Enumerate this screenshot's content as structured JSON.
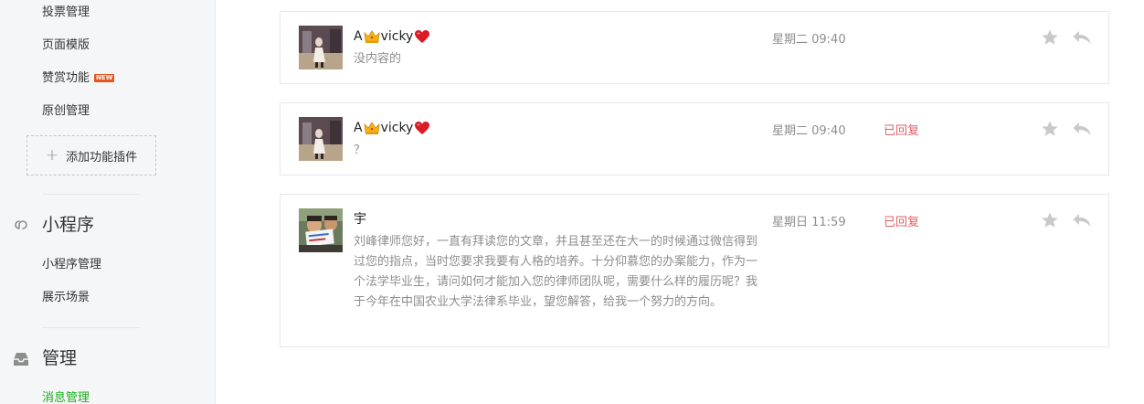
{
  "sidebar": {
    "items": [
      {
        "label": "投票管理"
      },
      {
        "label": "页面模版"
      },
      {
        "label": "赞赏功能",
        "badge": "NEW"
      },
      {
        "label": "原创管理"
      }
    ],
    "add_plugin_label": "添加功能插件",
    "miniprogram": {
      "title": "小程序",
      "items": [
        {
          "label": "小程序管理"
        },
        {
          "label": "展示场景"
        }
      ]
    },
    "manage": {
      "title": "管理",
      "items": [
        {
          "label": "消息管理",
          "active": true
        }
      ]
    },
    "active_color": "#1aad19"
  },
  "messages": [
    {
      "nick_prefix": "A",
      "nick_name": "vicky",
      "nick_emojis": [
        "crown-emoji",
        "heart-emoji"
      ],
      "content": "没内容的",
      "time": "星期二 09:40",
      "status": ""
    },
    {
      "nick_prefix": "A",
      "nick_name": "vicky",
      "nick_emojis": [
        "crown-emoji",
        "heart-emoji"
      ],
      "content": "？",
      "time": "星期二 09:40",
      "status": "已回复"
    },
    {
      "nick_name": "宇",
      "content": "刘峰律师您好，一直有拜读您的文章，并且甚至还在大一的时候通过微信得到过您的指点，当时您要求我要有人格的培养。十分仰慕您的办案能力，作为一个法学毕业生，请问如何才能加入您的律师团队呢，需要什么样的履历呢？我于今年在中国农业大学法律系毕业，望您解答，给我一个努力的方向。",
      "time": "星期日 11:59",
      "status": "已回复"
    }
  ],
  "colors": {
    "replied": "#e15f63",
    "muted": "#8d8d8d",
    "border": "#e7e7eb"
  }
}
